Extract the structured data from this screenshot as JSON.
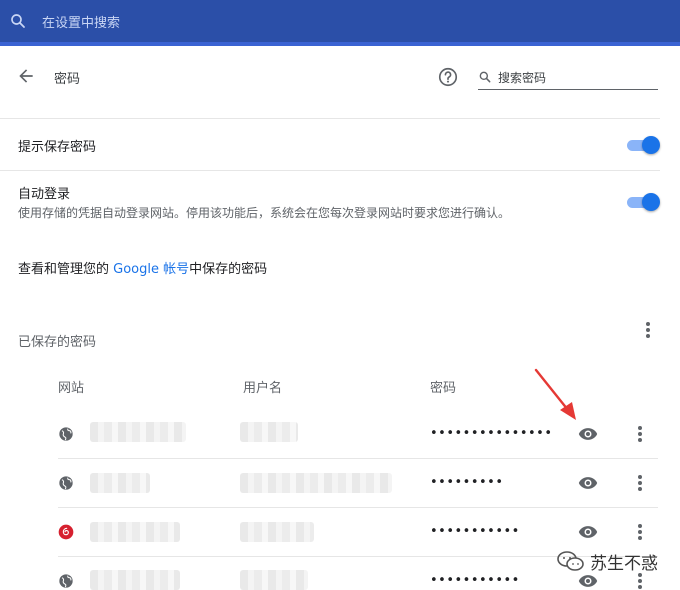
{
  "topbar": {
    "search_placeholder": "在设置中搜索"
  },
  "header": {
    "title": "密码",
    "search_placeholder": "搜索密码"
  },
  "settings": {
    "offer_to_save": {
      "label": "提示保存密码",
      "enabled": true
    },
    "auto_signin": {
      "label": "自动登录",
      "description": "使用存储的凭据自动登录网站。停用该功能后，系统会在您每次登录网站时要求您进行确认。",
      "enabled": true
    }
  },
  "manage": {
    "prefix": "查看和管理您的 ",
    "link": "Google 帐号",
    "suffix": "中保存的密码"
  },
  "saved": {
    "title": "已保存的密码",
    "columns": {
      "site": "网站",
      "username": "用户名",
      "password": "密码"
    },
    "rows": [
      {
        "icon": "globe-icon",
        "password_mask": "•••••••••••••••"
      },
      {
        "icon": "globe-icon",
        "password_mask": "•••••••••"
      },
      {
        "icon": "netease-music-icon",
        "password_mask": "•••••••••••"
      },
      {
        "icon": "globe-icon",
        "password_mask": "•••••••••••"
      }
    ]
  },
  "watermark": {
    "text": "苏生不惑"
  },
  "colors": {
    "topbar": "#2b4fa8",
    "accent": "#1a73e8",
    "toggle_track": "#8ab4f8",
    "arrow": "#e53935",
    "netease_red": "#d6202f"
  }
}
